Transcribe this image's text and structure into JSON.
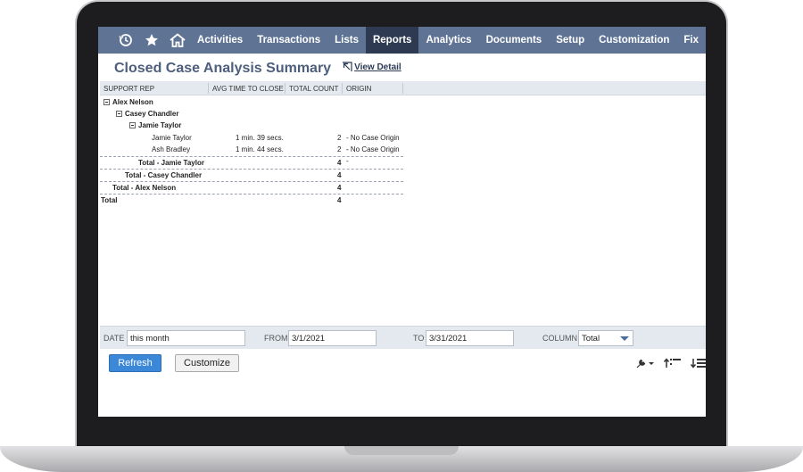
{
  "nav": {
    "icons": [
      "recent-icon",
      "star-icon",
      "home-icon"
    ],
    "items": [
      {
        "label": "Activities"
      },
      {
        "label": "Transactions"
      },
      {
        "label": "Lists"
      },
      {
        "label": "Reports"
      },
      {
        "label": "Analytics"
      },
      {
        "label": "Documents"
      },
      {
        "label": "Setup"
      },
      {
        "label": "Customization"
      },
      {
        "label": "Fix"
      }
    ],
    "active": "Reports"
  },
  "page": {
    "title": "Closed Case Analysis Summary",
    "view_detail": "View Detail"
  },
  "report": {
    "columns": [
      "SUPPORT REP",
      "AVG TIME TO CLOSE",
      "TOTAL COUNT",
      "ORIGIN"
    ],
    "rows": [
      {
        "name": "Alex Nelson"
      },
      {
        "name": "Casey Chandler"
      },
      {
        "name": "Jamie Taylor"
      },
      {
        "name": "Jamie Taylor",
        "avg": "1 min. 39 secs.",
        "count": "2",
        "origin": "- No Case Origin -"
      },
      {
        "name": "Ash Bradley",
        "avg": "1 min. 44 secs.",
        "count": "2",
        "origin": "- No Case Origin -"
      },
      {
        "name": "Total - Jamie Taylor",
        "count": "4"
      },
      {
        "name": "Total - Casey Chandler",
        "count": "4"
      },
      {
        "name": "Total - Alex Nelson",
        "count": "4"
      },
      {
        "name": "Total",
        "count": "4"
      }
    ]
  },
  "filters": {
    "date_label": "DATE",
    "date_value": "this month",
    "from_label": "FROM",
    "from_value": "3/1/2021",
    "to_label": "TO",
    "to_value": "3/31/2021",
    "column_label": "COLUMN",
    "column_value": "Total"
  },
  "buttons": {
    "refresh": "Refresh",
    "customize": "Customize"
  },
  "colors": {
    "navbar": "#5f7494",
    "nav_active": "#2d3a52",
    "title": "#4d5f7c",
    "refresh_button": "#3b87d8"
  }
}
